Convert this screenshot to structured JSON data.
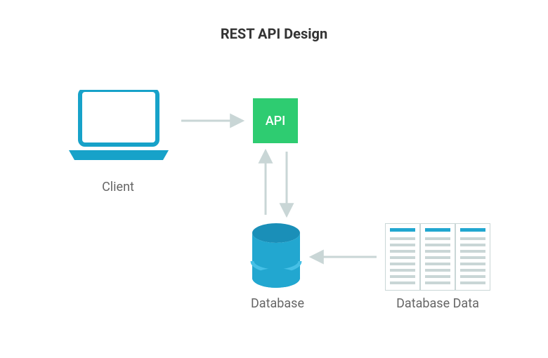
{
  "title": "REST API Design",
  "nodes": {
    "client": {
      "label": "Client"
    },
    "api": {
      "label": "API"
    },
    "database": {
      "label": "Database"
    },
    "databaseData": {
      "label": "Database Data"
    }
  },
  "colors": {
    "accent": "#17a2c9",
    "api": "#2ecc71",
    "arrow": "#c9d6d6",
    "text": "#666"
  }
}
